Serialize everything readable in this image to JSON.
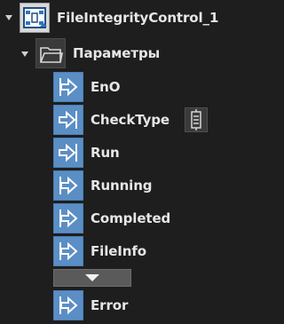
{
  "tree": {
    "root": {
      "label": "FileIntegrityControl_1",
      "icon": "function-block-icon",
      "expanded": true
    },
    "group": {
      "label": "Параметры",
      "icon": "folder-icon",
      "expanded": true
    },
    "pins": [
      {
        "label": "EnO",
        "icon": "output-pin-icon"
      },
      {
        "label": "CheckType",
        "icon": "input-pin-icon",
        "has_type_button": true
      },
      {
        "label": "Run",
        "icon": "input-pin-icon"
      },
      {
        "label": "Running",
        "icon": "output-pin-icon"
      },
      {
        "label": "Completed",
        "icon": "output-pin-icon"
      },
      {
        "label": "FileInfo",
        "icon": "output-pin-icon"
      },
      {
        "label": "Error",
        "icon": "output-pin-icon"
      }
    ]
  },
  "colors": {
    "background": "#1e1e1e",
    "pin_fill": "#5b8ec4",
    "text": "#e6e6e6"
  }
}
